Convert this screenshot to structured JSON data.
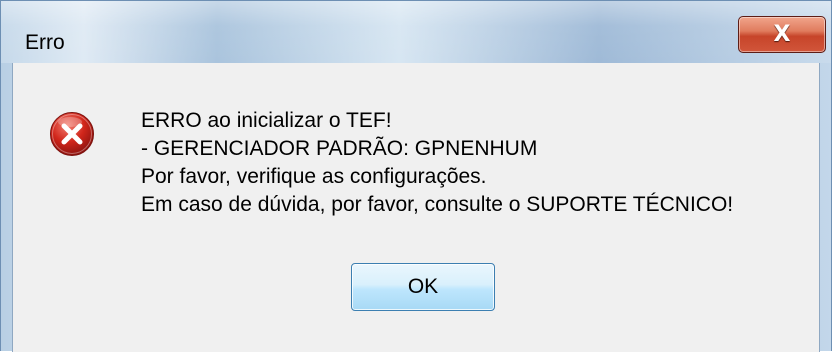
{
  "window": {
    "title": "Erro",
    "close_glyph": "X"
  },
  "dialog": {
    "icon": "error-icon",
    "message_lines": [
      "ERRO ao inicializar o TEF!",
      "- GERENCIADOR PADRÃO: GPNENHUM",
      "Por favor, verifique as configurações.",
      "Em caso de dúvida, por favor, consulte o SUPORTE TÉCNICO!"
    ],
    "ok_label": "OK"
  },
  "colors": {
    "error_red": "#d1261b",
    "button_blue": "#bee6fd",
    "close_red": "#c7452a"
  }
}
